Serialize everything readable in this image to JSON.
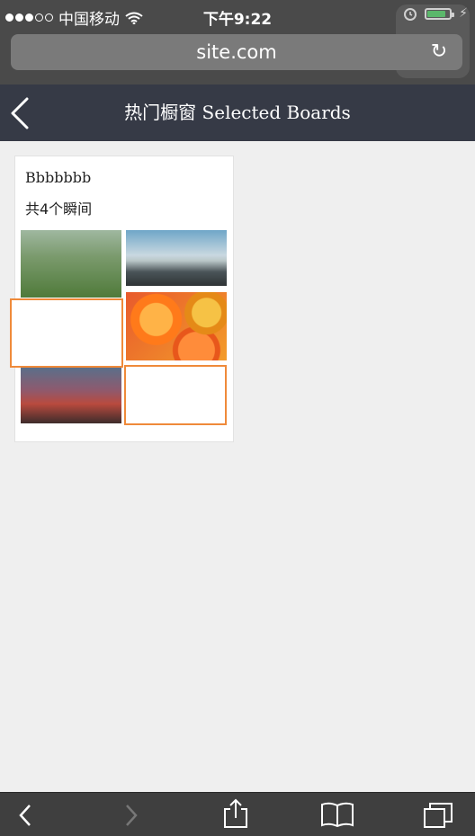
{
  "status_bar": {
    "carrier": "中国移动",
    "time": "下午9:22"
  },
  "browser": {
    "url": "site.com"
  },
  "header": {
    "title": "热门橱窗 Selected Boards"
  },
  "board": {
    "name": "Bbbbbbb",
    "count_text": "共4个瞬间"
  },
  "icons": {
    "back": "chevron-left-icon",
    "reload": "reload-icon",
    "share": "share-icon",
    "bookmarks": "book-icon",
    "tabs": "tabs-icon"
  },
  "colors": {
    "header_bg": "#363a46",
    "placeholder_outline": "#ef8a3a"
  }
}
